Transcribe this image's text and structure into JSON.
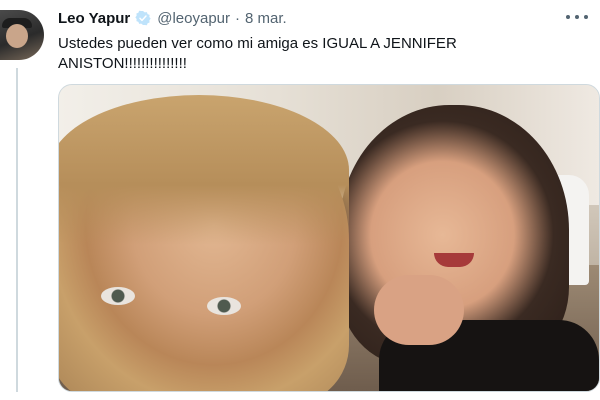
{
  "tweet": {
    "display_name": "Leo Yapur",
    "handle": "@leoyapur",
    "separator": "·",
    "date": "8 mar.",
    "text": "Ustedes pueden ver como mi amiga es IGUAL A JENNIFER ANISTON!!!!!!!!!!!!!!!",
    "verified_icon": "verified-badge-icon",
    "more_icon": "more-options-icon"
  },
  "colors": {
    "text_primary": "#0f1419",
    "text_secondary": "#536471",
    "border": "#cfd9de",
    "verified": "#1d9bf0"
  }
}
